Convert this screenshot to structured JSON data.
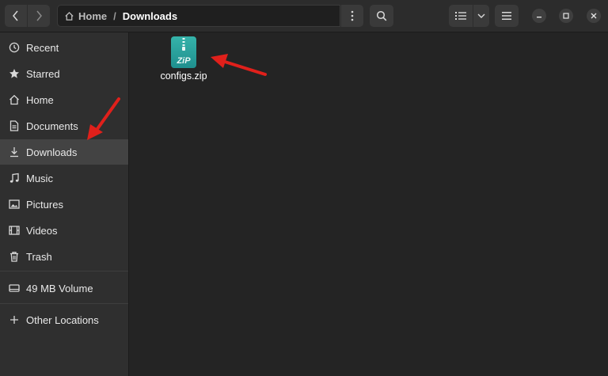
{
  "header": {
    "back_icon": "chevron-left-icon",
    "forward_icon": "chevron-right-icon",
    "path": {
      "home_label": "Home",
      "separator": "/",
      "current_label": "Downloads"
    },
    "path_menu_icon": "vertical-dots-icon",
    "search_icon": "search-icon",
    "view_icon": "list-view-icon",
    "view_dropdown_icon": "chevron-down-icon",
    "menu_icon": "hamburger-icon",
    "window_controls": [
      "minimize-icon",
      "maximize-icon",
      "close-icon"
    ]
  },
  "sidebar": {
    "items": [
      {
        "label": "Recent",
        "icon": "clock-icon"
      },
      {
        "label": "Starred",
        "icon": "star-icon"
      },
      {
        "label": "Home",
        "icon": "home-icon"
      },
      {
        "label": "Documents",
        "icon": "document-icon"
      },
      {
        "label": "Downloads",
        "icon": "download-icon",
        "active": true
      },
      {
        "label": "Music",
        "icon": "music-note-icon"
      },
      {
        "label": "Pictures",
        "icon": "picture-icon"
      },
      {
        "label": "Videos",
        "icon": "film-icon"
      },
      {
        "label": "Trash",
        "icon": "trash-icon"
      }
    ],
    "volumes": [
      {
        "label": "49 MB Volume",
        "icon": "drive-icon"
      }
    ],
    "other": {
      "label": "Other Locations",
      "icon": "plus-icon"
    }
  },
  "files": [
    {
      "name": "configs.zip",
      "icon": "zip-archive-icon",
      "icon_text": "ZiP"
    }
  ],
  "colors": {
    "accent_zip": "#2a9d9b",
    "annotation_arrow": "#e0201b"
  }
}
